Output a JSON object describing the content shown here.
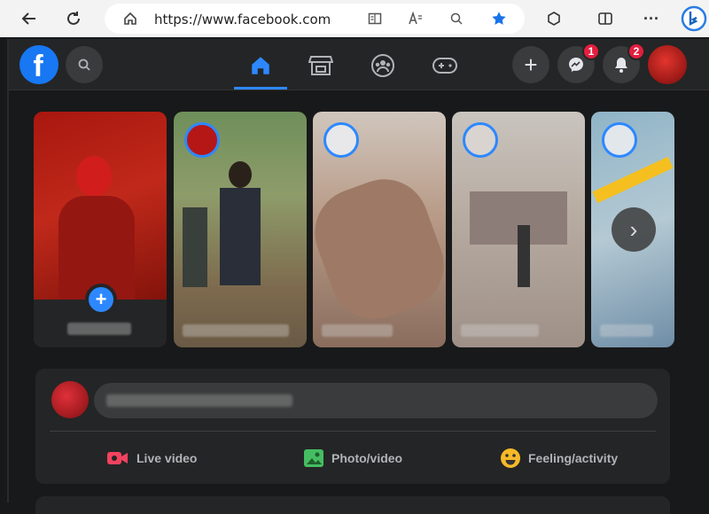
{
  "browser": {
    "url": "https://www.facebook.com",
    "icons": [
      "back-arrow-icon",
      "refresh-icon",
      "home-icon",
      "reader-icon",
      "read-aloud-icon",
      "zoom-icon",
      "favorite-star-icon",
      "extensions-icon",
      "split-screen-icon",
      "more-icon",
      "bing-icon"
    ]
  },
  "facebook": {
    "logo": "f",
    "nav": [
      "home-icon",
      "marketplace-icon",
      "groups-icon",
      "gaming-icon"
    ],
    "actions": {
      "create": "+",
      "messenger_badge": "1",
      "notifications_badge": "2"
    },
    "stories": {
      "next_label": "›"
    },
    "composer": {
      "actions": [
        {
          "label": "Live video",
          "color": "#f3425f"
        },
        {
          "label": "Photo/video",
          "color": "#45bd62"
        },
        {
          "label": "Feeling/activity",
          "color": "#f7b928"
        }
      ]
    }
  }
}
